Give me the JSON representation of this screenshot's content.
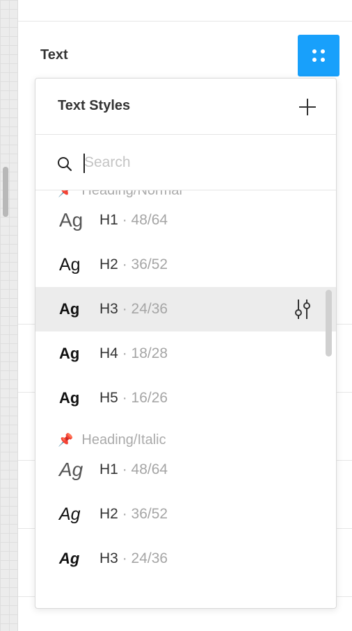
{
  "panel": {
    "section_title": "Text",
    "styles_button_icon": "grid-dots-icon"
  },
  "dropdown": {
    "title": "Text Styles",
    "add_icon": "plus-icon",
    "search": {
      "placeholder": "Search",
      "value": ""
    },
    "groups": [
      {
        "name": "Heading/Normal",
        "icon": "pin-icon",
        "items": [
          {
            "sample": "Ag",
            "name": "H1",
            "sep": "·",
            "metric": "48/64",
            "weight": "300"
          },
          {
            "sample": "Ag",
            "name": "H2",
            "sep": "·",
            "metric": "36/52",
            "weight": "400"
          },
          {
            "sample": "Ag",
            "name": "H3",
            "sep": "·",
            "metric": "24/36",
            "weight": "700",
            "selected": true,
            "action_icon": "adjust-sliders-icon"
          },
          {
            "sample": "Ag",
            "name": "H4",
            "sep": "·",
            "metric": "18/28",
            "weight": "700"
          },
          {
            "sample": "Ag",
            "name": "H5",
            "sep": "·",
            "metric": "16/26",
            "weight": "700"
          }
        ]
      },
      {
        "name": "Heading/Italic",
        "icon": "pin-icon",
        "items": [
          {
            "sample": "Ag",
            "name": "H1",
            "sep": "·",
            "metric": "48/64",
            "weight": "300"
          },
          {
            "sample": "Ag",
            "name": "H2",
            "sep": "·",
            "metric": "36/52",
            "weight": "400"
          },
          {
            "sample": "Ag",
            "name": "H3",
            "sep": "·",
            "metric": "24/36",
            "weight": "700"
          }
        ]
      }
    ]
  },
  "colors": {
    "accent": "#18a0fb",
    "selected_row": "#ececec",
    "muted_text": "#a5a5a5"
  }
}
